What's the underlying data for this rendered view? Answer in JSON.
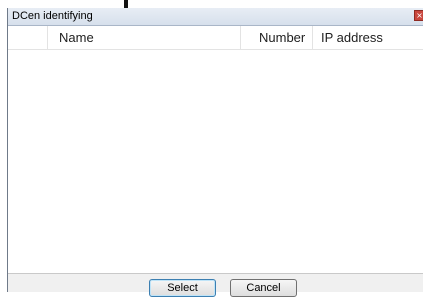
{
  "dialog": {
    "title": "DCen identifying",
    "close_glyph": "×"
  },
  "list": {
    "columns": [
      "",
      "Name",
      "Number",
      "IP address"
    ],
    "rows": []
  },
  "buttons": {
    "select_label": "Select",
    "cancel_label": "Cancel"
  },
  "colors": {
    "titlebar": "#dbe4f0",
    "close": "#c9463d",
    "list_background": "#ffffff",
    "dialog_background": "#f0f0f0"
  }
}
